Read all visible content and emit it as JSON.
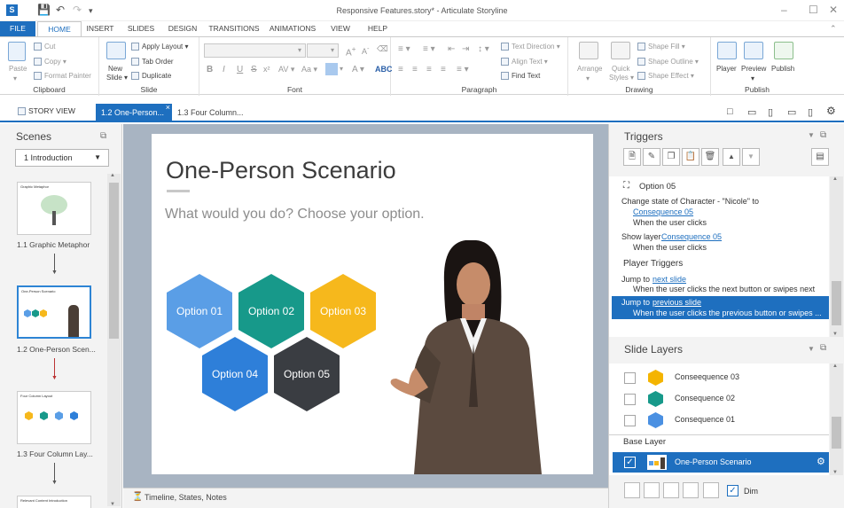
{
  "titlebar": {
    "app_icon_letter": "S",
    "title": "Responsive Features.story* - Articulate Storyline",
    "minimize": "–",
    "maximize": "☐",
    "close": "✕"
  },
  "ribbon_tabs": [
    "FILE",
    "HOME",
    "INSERT",
    "SLIDES",
    "DESIGN",
    "TRANSITIONS",
    "ANIMATIONS",
    "VIEW",
    "HELP"
  ],
  "ribbon": {
    "clipboard": {
      "paste": "Paste",
      "cut": "Cut",
      "copy": "Copy",
      "format_painter": "Format Painter",
      "label": "Clipboard"
    },
    "slide": {
      "new_slide": "New",
      "new_slide2": "Slide",
      "apply_layout": "Apply Layout",
      "tab_order": "Tab Order",
      "duplicate": "Duplicate",
      "label": "Slide"
    },
    "font": {
      "label": "Font"
    },
    "paragraph": {
      "text_direction": "Text Direction",
      "align_text": "Align Text",
      "find_text": "Find Text",
      "label": "Paragraph"
    },
    "drawing": {
      "arrange": "Arrange",
      "quick": "Quick",
      "styles": "Styles",
      "shape_fill": "Shape Fill",
      "shape_outline": "Shape Outline",
      "shape_effect": "Shape Effect",
      "label": "Drawing"
    },
    "publish": {
      "player": "Player",
      "preview": "Preview",
      "publish": "Publish",
      "label": "Publish"
    }
  },
  "doc_tabs": {
    "story_view": "STORY VIEW",
    "active": "1.2 One-Person...",
    "inactive": "1.3 Four Column...",
    "close": "×"
  },
  "scenes": {
    "header": "Scenes",
    "dropdown": "1 Introduction",
    "items": [
      {
        "label": "1.1 Graphic Metaphor",
        "thumb_title": "Graphic Metaphor"
      },
      {
        "label": "1.2 One-Person Scen...",
        "thumb_title": "One-Person Scenario"
      },
      {
        "label": "1.3 Four Column Lay...",
        "thumb_title": "Four Column Layout"
      },
      {
        "label": "",
        "thumb_title": "Relevant Content Introduction"
      }
    ]
  },
  "slide": {
    "title": "One-Person Scenario",
    "subtitle": "What would you do? Choose your option.",
    "options": [
      "Option 01",
      "Option 02",
      "Option 03",
      "Option 04",
      "Option 05"
    ]
  },
  "timeline_label": "Timeline, States, Notes",
  "triggers": {
    "header": "Triggers",
    "option05": "Option 05",
    "t1_action": "Change state of Character - \"Nicole\" to",
    "t1_target": "Consequence 05",
    "t1_when": "When the user clicks",
    "t2_action": "Show layer",
    "t2_target": "Consequence 05",
    "t2_when": "When the user clicks",
    "player_triggers": "Player Triggers",
    "t3_action": "Jump to",
    "t3_target": "next slide",
    "t3_when": "When the user clicks the next button or swipes next",
    "t4_action": "Jump to",
    "t4_target": "previous slide",
    "t4_when": "When the user clicks the previous button or swipes ..."
  },
  "slide_layers": {
    "header": "Slide Layers",
    "layers": [
      {
        "name": "Conseequence 03",
        "color": "#f4b400"
      },
      {
        "name": "Consequence 02",
        "color": "#17998a"
      },
      {
        "name": "Consequence 01",
        "color": "#4a90e2"
      }
    ],
    "base_label": "Base Layer",
    "base_name": "One-Person Scenario",
    "dim": "Dim"
  },
  "colors": {
    "accent": "#1e6fbf",
    "hex_blue_light": "#5a9ee6",
    "hex_teal": "#17998a",
    "hex_yellow": "#f6b81c",
    "hex_blue": "#2e7fd9",
    "hex_dark": "#3a3d42"
  }
}
